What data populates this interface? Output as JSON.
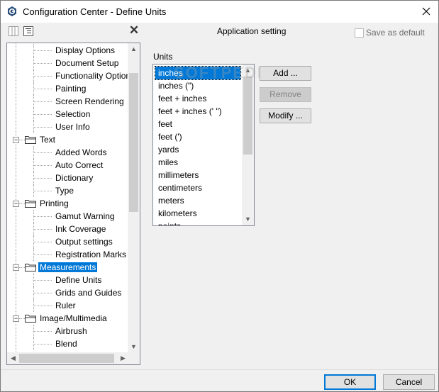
{
  "window": {
    "title": "Configuration Center - Define Units"
  },
  "toolbar": {
    "section_title": "Application setting",
    "save_default_label": "Save as default",
    "save_default_checked": false
  },
  "tree": {
    "items": [
      {
        "label": "Display Options",
        "level": 2
      },
      {
        "label": "Document Setup",
        "level": 2
      },
      {
        "label": "Functionality Options",
        "level": 2
      },
      {
        "label": "Painting",
        "level": 2
      },
      {
        "label": "Screen Rendering",
        "level": 2
      },
      {
        "label": "Selection",
        "level": 2
      },
      {
        "label": "User Info",
        "level": 2
      },
      {
        "label": "Text",
        "level": 1,
        "expanded": true
      },
      {
        "label": "Added Words",
        "level": 2
      },
      {
        "label": "Auto Correct",
        "level": 2
      },
      {
        "label": "Dictionary",
        "level": 2
      },
      {
        "label": "Type",
        "level": 2
      },
      {
        "label": "Printing",
        "level": 1,
        "expanded": true
      },
      {
        "label": "Gamut Warning",
        "level": 2
      },
      {
        "label": "Ink Coverage",
        "level": 2
      },
      {
        "label": "Output settings",
        "level": 2
      },
      {
        "label": "Registration Marks",
        "level": 2
      },
      {
        "label": "Measurements",
        "level": 1,
        "expanded": true,
        "selected": true
      },
      {
        "label": "Define Units",
        "level": 2
      },
      {
        "label": "Grids and Guides",
        "level": 2
      },
      {
        "label": "Ruler",
        "level": 2
      },
      {
        "label": "Image/Multimedia",
        "level": 1,
        "expanded": true
      },
      {
        "label": "Airbrush",
        "level": 2
      },
      {
        "label": "Blend",
        "level": 2
      }
    ]
  },
  "units": {
    "label": "Units",
    "items": [
      "inches",
      "inches (\")",
      "feet + inches",
      "feet + inches (' \")",
      "feet",
      "feet (')",
      "yards",
      "miles",
      "millimeters",
      "centimeters",
      "meters",
      "kilometers",
      "points"
    ],
    "selected": "inches",
    "add_label": "Add ...",
    "remove_label": "Remove",
    "modify_label": "Modify ..."
  },
  "watermark": "SOFTPEDIA",
  "footer": {
    "ok_label": "OK",
    "cancel_label": "Cancel"
  },
  "colors": {
    "selection": "#0078d7",
    "folder": "#f0c75c"
  }
}
